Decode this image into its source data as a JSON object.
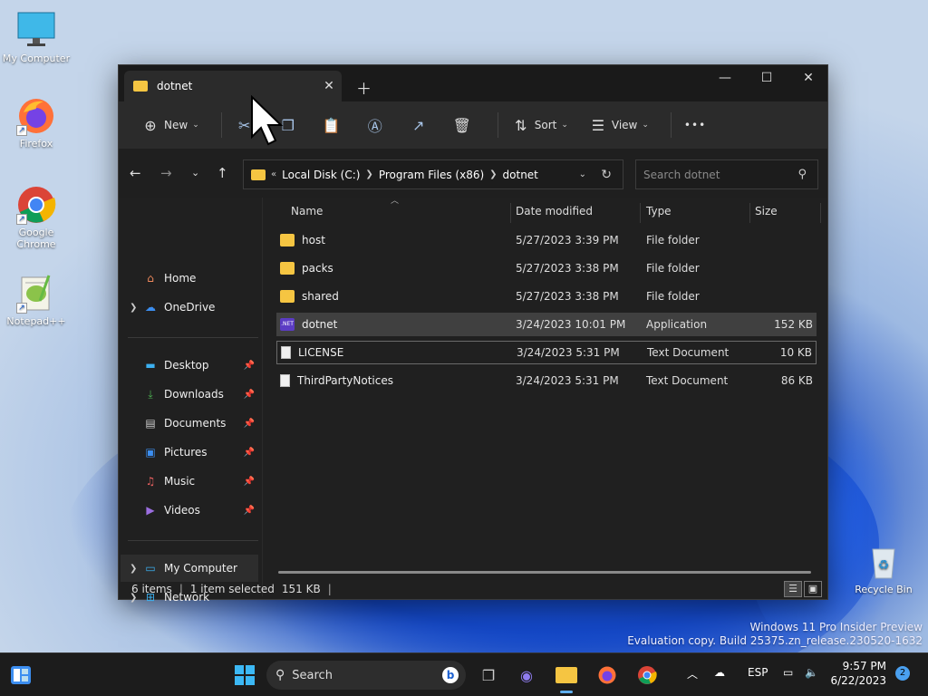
{
  "desktop": {
    "icons": [
      {
        "label": "My Computer"
      },
      {
        "label": "Firefox"
      },
      {
        "label": "Google Chrome"
      },
      {
        "label": "Notepad++"
      },
      {
        "label": "Recycle Bin"
      }
    ],
    "watermark": {
      "line1": "Windows 11 Pro Insider Preview",
      "line2": "Evaluation copy. Build 25375.zn_release.230520-1632"
    }
  },
  "explorer": {
    "tab_title": "dotnet",
    "toolbar": {
      "new_label": "New",
      "sort_label": "Sort",
      "view_label": "View",
      "more_label": "•••"
    },
    "address": {
      "overflow": "«",
      "crumbs": [
        "Local Disk (C:)",
        "Program Files (x86)",
        "dotnet"
      ]
    },
    "search_placeholder": "Search dotnet",
    "sidebar": {
      "home": "Home",
      "onedrive": "OneDrive",
      "desktop": "Desktop",
      "downloads": "Downloads",
      "documents": "Documents",
      "pictures": "Pictures",
      "music": "Music",
      "videos": "Videos",
      "mycomputer": "My Computer",
      "network": "Network"
    },
    "columns": {
      "name": "Name",
      "date": "Date modified",
      "type": "Type",
      "size": "Size"
    },
    "files": [
      {
        "name": "host",
        "date": "5/27/2023 3:39 PM",
        "type": "File folder",
        "size": "",
        "icon": "folder-icon"
      },
      {
        "name": "packs",
        "date": "5/27/2023 3:38 PM",
        "type": "File folder",
        "size": "",
        "icon": "folder-icon"
      },
      {
        "name": "shared",
        "date": "5/27/2023 3:38 PM",
        "type": "File folder",
        "size": "",
        "icon": "folder-icon"
      },
      {
        "name": "dotnet",
        "date": "3/24/2023 10:01 PM",
        "type": "Application",
        "size": "152 KB",
        "icon": "dotnet-app-icon"
      },
      {
        "name": "LICENSE",
        "date": "3/24/2023 5:31 PM",
        "type": "Text Document",
        "size": "10 KB",
        "icon": "text-document-icon"
      },
      {
        "name": "ThirdPartyNotices",
        "date": "3/24/2023 5:31 PM",
        "type": "Text Document",
        "size": "86 KB",
        "icon": "text-document-icon"
      }
    ],
    "net_badge": ".NET",
    "status": {
      "items": "6 items",
      "selected": "1 item selected",
      "size": "151 KB"
    }
  },
  "taskbar": {
    "search_label": "Search",
    "lang": "ESP",
    "time": "9:57 PM",
    "date": "6/22/2023",
    "notifications": "2"
  }
}
